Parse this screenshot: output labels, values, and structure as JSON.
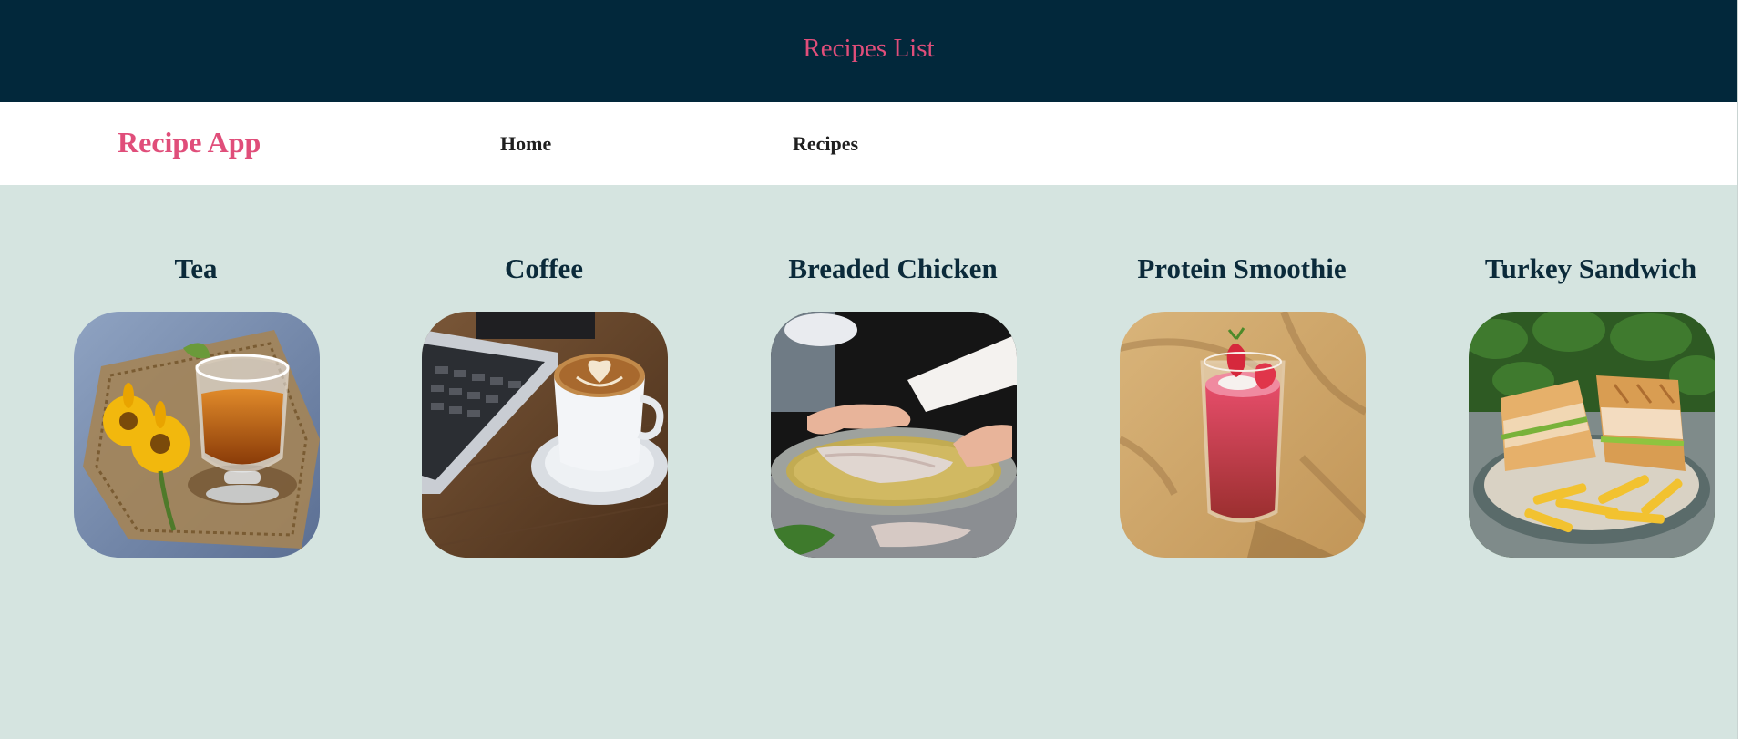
{
  "header": {
    "title": "Recipes List"
  },
  "nav": {
    "brand": "Recipe App",
    "links": [
      {
        "label": "Home"
      },
      {
        "label": "Recipes"
      }
    ]
  },
  "recipes": [
    {
      "title": "Tea",
      "image": "tea-glass-with-sunflowers"
    },
    {
      "title": "Coffee",
      "image": "latte-cup-beside-laptop"
    },
    {
      "title": "Breaded Chicken",
      "image": "hands-breading-chicken"
    },
    {
      "title": "Protein Smoothie",
      "image": "strawberry-smoothie-glass"
    },
    {
      "title": "Turkey Sandwich",
      "image": "sandwich-with-fries"
    }
  ],
  "colors": {
    "header_bg": "#02283b",
    "accent": "#e04e7a",
    "content_bg": "#d5e4e0",
    "heading": "#0b2a3a"
  }
}
